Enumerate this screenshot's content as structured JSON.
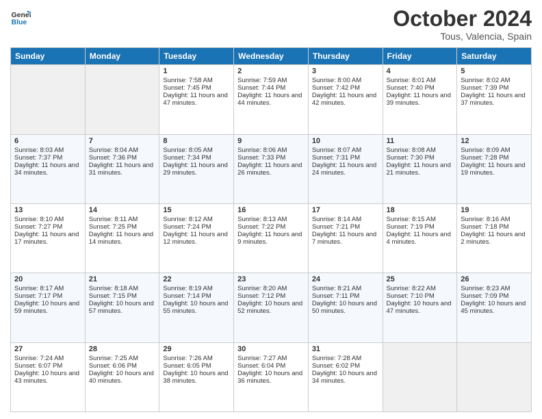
{
  "logo": {
    "line1": "General",
    "line2": "Blue"
  },
  "title": "October 2024",
  "subtitle": "Tous, Valencia, Spain",
  "weekdays": [
    "Sunday",
    "Monday",
    "Tuesday",
    "Wednesday",
    "Thursday",
    "Friday",
    "Saturday"
  ],
  "weeks": [
    [
      {
        "day": "",
        "sunrise": "",
        "sunset": "",
        "daylight": ""
      },
      {
        "day": "",
        "sunrise": "",
        "sunset": "",
        "daylight": ""
      },
      {
        "day": "1",
        "sunrise": "Sunrise: 7:58 AM",
        "sunset": "Sunset: 7:45 PM",
        "daylight": "Daylight: 11 hours and 47 minutes."
      },
      {
        "day": "2",
        "sunrise": "Sunrise: 7:59 AM",
        "sunset": "Sunset: 7:44 PM",
        "daylight": "Daylight: 11 hours and 44 minutes."
      },
      {
        "day": "3",
        "sunrise": "Sunrise: 8:00 AM",
        "sunset": "Sunset: 7:42 PM",
        "daylight": "Daylight: 11 hours and 42 minutes."
      },
      {
        "day": "4",
        "sunrise": "Sunrise: 8:01 AM",
        "sunset": "Sunset: 7:40 PM",
        "daylight": "Daylight: 11 hours and 39 minutes."
      },
      {
        "day": "5",
        "sunrise": "Sunrise: 8:02 AM",
        "sunset": "Sunset: 7:39 PM",
        "daylight": "Daylight: 11 hours and 37 minutes."
      }
    ],
    [
      {
        "day": "6",
        "sunrise": "Sunrise: 8:03 AM",
        "sunset": "Sunset: 7:37 PM",
        "daylight": "Daylight: 11 hours and 34 minutes."
      },
      {
        "day": "7",
        "sunrise": "Sunrise: 8:04 AM",
        "sunset": "Sunset: 7:36 PM",
        "daylight": "Daylight: 11 hours and 31 minutes."
      },
      {
        "day": "8",
        "sunrise": "Sunrise: 8:05 AM",
        "sunset": "Sunset: 7:34 PM",
        "daylight": "Daylight: 11 hours and 29 minutes."
      },
      {
        "day": "9",
        "sunrise": "Sunrise: 8:06 AM",
        "sunset": "Sunset: 7:33 PM",
        "daylight": "Daylight: 11 hours and 26 minutes."
      },
      {
        "day": "10",
        "sunrise": "Sunrise: 8:07 AM",
        "sunset": "Sunset: 7:31 PM",
        "daylight": "Daylight: 11 hours and 24 minutes."
      },
      {
        "day": "11",
        "sunrise": "Sunrise: 8:08 AM",
        "sunset": "Sunset: 7:30 PM",
        "daylight": "Daylight: 11 hours and 21 minutes."
      },
      {
        "day": "12",
        "sunrise": "Sunrise: 8:09 AM",
        "sunset": "Sunset: 7:28 PM",
        "daylight": "Daylight: 11 hours and 19 minutes."
      }
    ],
    [
      {
        "day": "13",
        "sunrise": "Sunrise: 8:10 AM",
        "sunset": "Sunset: 7:27 PM",
        "daylight": "Daylight: 11 hours and 17 minutes."
      },
      {
        "day": "14",
        "sunrise": "Sunrise: 8:11 AM",
        "sunset": "Sunset: 7:25 PM",
        "daylight": "Daylight: 11 hours and 14 minutes."
      },
      {
        "day": "15",
        "sunrise": "Sunrise: 8:12 AM",
        "sunset": "Sunset: 7:24 PM",
        "daylight": "Daylight: 11 hours and 12 minutes."
      },
      {
        "day": "16",
        "sunrise": "Sunrise: 8:13 AM",
        "sunset": "Sunset: 7:22 PM",
        "daylight": "Daylight: 11 hours and 9 minutes."
      },
      {
        "day": "17",
        "sunrise": "Sunrise: 8:14 AM",
        "sunset": "Sunset: 7:21 PM",
        "daylight": "Daylight: 11 hours and 7 minutes."
      },
      {
        "day": "18",
        "sunrise": "Sunrise: 8:15 AM",
        "sunset": "Sunset: 7:19 PM",
        "daylight": "Daylight: 11 hours and 4 minutes."
      },
      {
        "day": "19",
        "sunrise": "Sunrise: 8:16 AM",
        "sunset": "Sunset: 7:18 PM",
        "daylight": "Daylight: 11 hours and 2 minutes."
      }
    ],
    [
      {
        "day": "20",
        "sunrise": "Sunrise: 8:17 AM",
        "sunset": "Sunset: 7:17 PM",
        "daylight": "Daylight: 10 hours and 59 minutes."
      },
      {
        "day": "21",
        "sunrise": "Sunrise: 8:18 AM",
        "sunset": "Sunset: 7:15 PM",
        "daylight": "Daylight: 10 hours and 57 minutes."
      },
      {
        "day": "22",
        "sunrise": "Sunrise: 8:19 AM",
        "sunset": "Sunset: 7:14 PM",
        "daylight": "Daylight: 10 hours and 55 minutes."
      },
      {
        "day": "23",
        "sunrise": "Sunrise: 8:20 AM",
        "sunset": "Sunset: 7:12 PM",
        "daylight": "Daylight: 10 hours and 52 minutes."
      },
      {
        "day": "24",
        "sunrise": "Sunrise: 8:21 AM",
        "sunset": "Sunset: 7:11 PM",
        "daylight": "Daylight: 10 hours and 50 minutes."
      },
      {
        "day": "25",
        "sunrise": "Sunrise: 8:22 AM",
        "sunset": "Sunset: 7:10 PM",
        "daylight": "Daylight: 10 hours and 47 minutes."
      },
      {
        "day": "26",
        "sunrise": "Sunrise: 8:23 AM",
        "sunset": "Sunset: 7:09 PM",
        "daylight": "Daylight: 10 hours and 45 minutes."
      }
    ],
    [
      {
        "day": "27",
        "sunrise": "Sunrise: 7:24 AM",
        "sunset": "Sunset: 6:07 PM",
        "daylight": "Daylight: 10 hours and 43 minutes."
      },
      {
        "day": "28",
        "sunrise": "Sunrise: 7:25 AM",
        "sunset": "Sunset: 6:06 PM",
        "daylight": "Daylight: 10 hours and 40 minutes."
      },
      {
        "day": "29",
        "sunrise": "Sunrise: 7:26 AM",
        "sunset": "Sunset: 6:05 PM",
        "daylight": "Daylight: 10 hours and 38 minutes."
      },
      {
        "day": "30",
        "sunrise": "Sunrise: 7:27 AM",
        "sunset": "Sunset: 6:04 PM",
        "daylight": "Daylight: 10 hours and 36 minutes."
      },
      {
        "day": "31",
        "sunrise": "Sunrise: 7:28 AM",
        "sunset": "Sunset: 6:02 PM",
        "daylight": "Daylight: 10 hours and 34 minutes."
      },
      {
        "day": "",
        "sunrise": "",
        "sunset": "",
        "daylight": ""
      },
      {
        "day": "",
        "sunrise": "",
        "sunset": "",
        "daylight": ""
      }
    ]
  ]
}
